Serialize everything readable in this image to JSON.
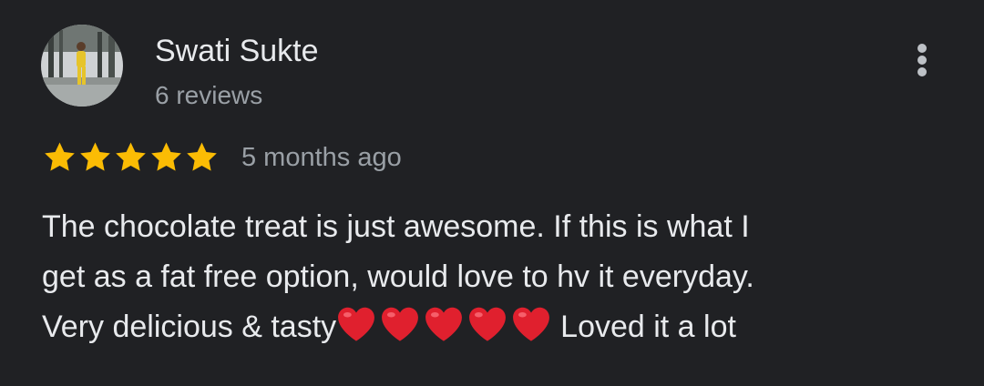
{
  "review": {
    "author": {
      "name": "Swati Sukte",
      "review_count": "6 reviews",
      "avatar_icon": "profile-photo-icon"
    },
    "more_options_icon": "more-vert-icon",
    "rating": {
      "stars": 5,
      "max_stars": 5,
      "star_icon": "star-icon",
      "star_color": "#fbbc04"
    },
    "timestamp": "5 months ago",
    "text": {
      "line1": "The chocolate treat is just awesome. If this is what I",
      "line2": "get as a fat free option, would love to hv it everyday.",
      "line3_start": "Very delicious & tasty",
      "hearts": 5,
      "heart_icon": "red-heart-icon",
      "heart_color": "#e0202e",
      "line3_end": "Loved it a lot"
    }
  },
  "colors": {
    "background": "#202124",
    "primary_text": "#e8eaed",
    "secondary_text": "#9aa0a6"
  }
}
